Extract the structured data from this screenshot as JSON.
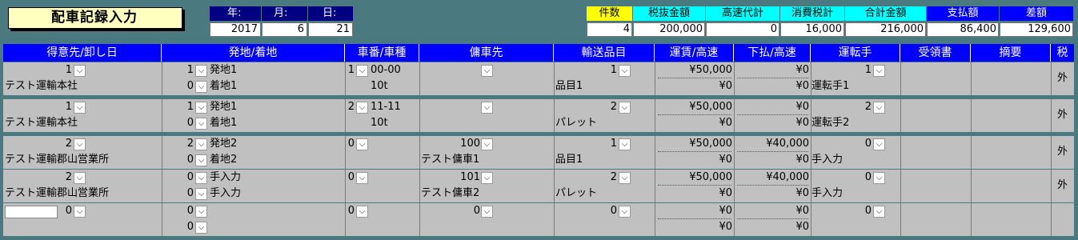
{
  "title": "配車記録入力",
  "date": {
    "labels": [
      "年:",
      "月:",
      "日:"
    ],
    "values": [
      "2017",
      "6",
      "21"
    ]
  },
  "summary": {
    "labels": [
      "件数",
      "税抜金額",
      "高速代計",
      "消費税計",
      "合計金額",
      "支払額",
      "差額"
    ],
    "values": [
      "4",
      "200,000",
      "0",
      "16,000",
      "216,000",
      "86,400",
      "129,600"
    ],
    "label_colors": [
      "#ffff00",
      "#00ffff",
      "#00ffff",
      "#00ffff",
      "#00ffff",
      "#0000ff",
      "#0000ff"
    ],
    "label_text_colors": [
      "#000000",
      "#000000",
      "#000000",
      "#000000",
      "#000000",
      "#ffffff",
      "#ffffff"
    ]
  },
  "columns": [
    "得意先/卸し日",
    "発地/着地",
    "車番/車種",
    "傭車先",
    "輸送品目",
    "運賃/高速",
    "下払/高速",
    "運転手",
    "受領書",
    "摘要",
    "税"
  ],
  "records": [
    {
      "cust_code": "1",
      "cust_name": "テスト運輸本社",
      "from_code": "1",
      "from_name": "発地1",
      "to_code": "0",
      "to_name": "着地1",
      "car_code": "1",
      "car_no": "00-00",
      "car_type": "10t",
      "sub_code": "",
      "sub_name": "",
      "item_code": "1",
      "item_name": "品目1",
      "fare": "¥50,000",
      "fare_hw": "¥0",
      "pay": "¥0",
      "pay_hw": "¥0",
      "drv_code": "1",
      "drv_name": "運転手1",
      "tax": "外"
    },
    {
      "cust_code": "1",
      "cust_name": "テスト運輸本社",
      "from_code": "1",
      "from_name": "発地1",
      "to_code": "0",
      "to_name": "着地1",
      "car_code": "2",
      "car_no": "11-11",
      "car_type": "10t",
      "sub_code": "",
      "sub_name": "",
      "item_code": "2",
      "item_name": "パレット",
      "fare": "¥50,000",
      "fare_hw": "¥0",
      "pay": "¥0",
      "pay_hw": "¥0",
      "drv_code": "2",
      "drv_name": "運転手2",
      "tax": "外"
    },
    {
      "cust_code": "2",
      "cust_name": "テスト運輸郡山営業所",
      "from_code": "2",
      "from_name": "発地2",
      "to_code": "0",
      "to_name": "着地2",
      "car_code": "0",
      "car_no": "",
      "car_type": "",
      "sub_code": "100",
      "sub_name": "テスト傭車1",
      "item_code": "1",
      "item_name": "品目1",
      "fare": "¥50,000",
      "fare_hw": "¥0",
      "pay": "¥40,000",
      "pay_hw": "¥0",
      "drv_code": "0",
      "drv_name": "手入力",
      "tax": "外"
    },
    {
      "cust_code": "2",
      "cust_name": "テスト運輸郡山営業所",
      "from_code": "0",
      "from_name": "手入力",
      "to_code": "0",
      "to_name": "手入力",
      "car_code": "0",
      "car_no": "",
      "car_type": "",
      "sub_code": "101",
      "sub_name": "テスト傭車2",
      "item_code": "2",
      "item_name": "パレット",
      "fare": "¥50,000",
      "fare_hw": "¥0",
      "pay": "¥40,000",
      "pay_hw": "¥0",
      "drv_code": "0",
      "drv_name": "手入力",
      "tax": "外"
    },
    {
      "cust_code": "0",
      "cust_name": "",
      "from_code": "0",
      "from_name": "",
      "to_code": "0",
      "to_name": "",
      "car_code": "0",
      "car_no": "",
      "car_type": "",
      "sub_code": "0",
      "sub_name": "",
      "item_code": "0",
      "item_name": "",
      "fare": "¥0",
      "fare_hw": "¥0",
      "pay": "¥0",
      "pay_hw": "¥0",
      "drv_code": "0",
      "drv_name": "",
      "tax": ""
    }
  ]
}
